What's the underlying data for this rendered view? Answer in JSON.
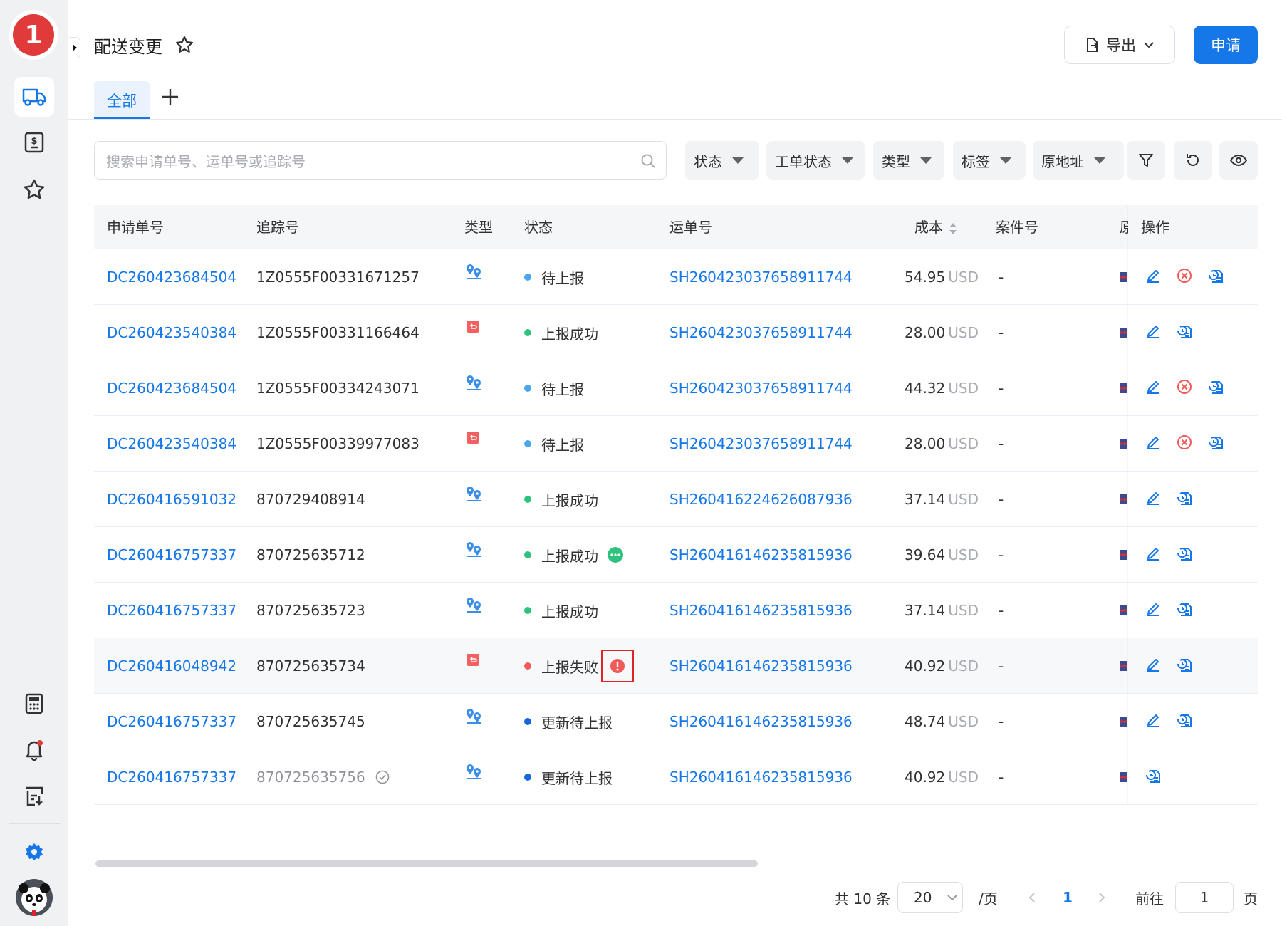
{
  "app": {
    "logo_text": "1"
  },
  "header": {
    "title": "配送变更",
    "export_label": "导出",
    "apply_label": "申请"
  },
  "tabs": [
    {
      "label": "全部"
    }
  ],
  "search": {
    "placeholder": "搜索申请单号、运单号或追踪号"
  },
  "filters": [
    "状态",
    "工单状态",
    "类型",
    "标签",
    "原地址"
  ],
  "columns": {
    "apply_no": "申请单号",
    "tracking": "追踪号",
    "type": "类型",
    "status": "状态",
    "waybill": "运单号",
    "cost": "成本",
    "case": "案件号",
    "origin": "原",
    "actions": "操作"
  },
  "colors": {
    "primary": "#1677e8",
    "pending": "#4aa5ef",
    "success": "#2fc27e",
    "failed": "#f05a5a",
    "update_pending": "#1666dd"
  },
  "rows": [
    {
      "apply_no": "DC260423684504",
      "tracking": "1Z0555F00331671257",
      "type_icon": "location-change-icon",
      "status": "待上报",
      "status_color": "#4aa5ef",
      "status_extra": "",
      "waybill": "SH260423037658911744",
      "cost": "54.95",
      "currency": "USD",
      "case": "-",
      "actions": [
        "edit",
        "cancel",
        "history"
      ]
    },
    {
      "apply_no": "DC260423540384",
      "tracking": "1Z0555F00331166464",
      "type_icon": "return-icon",
      "status": "上报成功",
      "status_color": "#2fc27e",
      "status_extra": "",
      "waybill": "SH260423037658911744",
      "cost": "28.00",
      "currency": "USD",
      "case": "-",
      "actions": [
        "edit",
        "history"
      ]
    },
    {
      "apply_no": "DC260423684504",
      "tracking": "1Z0555F00334243071",
      "type_icon": "location-change-icon",
      "status": "待上报",
      "status_color": "#4aa5ef",
      "status_extra": "",
      "waybill": "SH260423037658911744",
      "cost": "44.32",
      "currency": "USD",
      "case": "-",
      "actions": [
        "edit",
        "cancel",
        "history"
      ]
    },
    {
      "apply_no": "DC260423540384",
      "tracking": "1Z0555F00339977083",
      "type_icon": "return-icon",
      "status": "待上报",
      "status_color": "#4aa5ef",
      "status_extra": "",
      "waybill": "SH260423037658911744",
      "cost": "28.00",
      "currency": "USD",
      "case": "-",
      "actions": [
        "edit",
        "cancel",
        "history"
      ]
    },
    {
      "apply_no": "DC260416591032",
      "tracking": "870729408914",
      "type_icon": "location-change-icon",
      "status": "上报成功",
      "status_color": "#2fc27e",
      "status_extra": "",
      "waybill": "SH260416224626087936",
      "cost": "37.14",
      "currency": "USD",
      "case": "-",
      "actions": [
        "edit",
        "history"
      ]
    },
    {
      "apply_no": "DC260416757337",
      "tracking": "870725635712",
      "type_icon": "location-change-icon",
      "status": "上报成功",
      "status_color": "#2fc27e",
      "status_extra": "more",
      "waybill": "SH260416146235815936",
      "cost": "39.64",
      "currency": "USD",
      "case": "-",
      "actions": [
        "edit",
        "history"
      ]
    },
    {
      "apply_no": "DC260416757337",
      "tracking": "870725635723",
      "type_icon": "location-change-icon",
      "status": "上报成功",
      "status_color": "#2fc27e",
      "status_extra": "",
      "waybill": "SH260416146235815936",
      "cost": "37.14",
      "currency": "USD",
      "case": "-",
      "actions": [
        "edit",
        "history"
      ]
    },
    {
      "apply_no": "DC260416048942",
      "tracking": "870725635734",
      "type_icon": "return-icon",
      "status": "上报失败",
      "status_color": "#f05a5a",
      "status_extra": "error",
      "waybill": "SH260416146235815936",
      "cost": "40.92",
      "currency": "USD",
      "case": "-",
      "actions": [
        "edit",
        "history"
      ]
    },
    {
      "apply_no": "DC260416757337",
      "tracking": "870725635745",
      "type_icon": "location-change-icon",
      "status": "更新待上报",
      "status_color": "#1666dd",
      "status_extra": "",
      "waybill": "SH260416146235815936",
      "cost": "48.74",
      "currency": "USD",
      "case": "-",
      "actions": [
        "edit",
        "history"
      ]
    },
    {
      "apply_no": "DC260416757337",
      "tracking": "870725635756",
      "tracking_verified": true,
      "type_icon": "location-change-icon",
      "status": "更新待上报",
      "status_color": "#1666dd",
      "status_extra": "",
      "waybill": "SH260416146235815936",
      "cost": "40.92",
      "currency": "USD",
      "case": "-",
      "actions": [
        "history"
      ]
    }
  ],
  "pagination": {
    "total_text": "共 10 条",
    "page_size": "20",
    "per_page_label": "/页",
    "current_page": "1",
    "goto_label": "前往",
    "goto_value": "1",
    "page_suffix": "页"
  }
}
